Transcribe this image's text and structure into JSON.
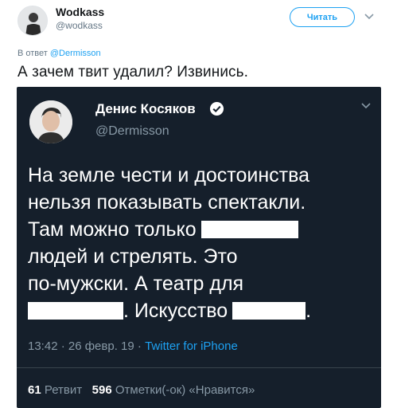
{
  "header": {
    "name": "Wodkass",
    "handle": "@wodkass",
    "follow_label": "Читать"
  },
  "reply": {
    "prefix": "В ответ",
    "mention": "@Dermisson"
  },
  "tweet": {
    "text": "А зачем твит удалил? Извинись."
  },
  "screenshot": {
    "name": "Денис Косяков",
    "handle": "@Dermisson",
    "line1": "На земле чести и достоинства",
    "line2": "нельзя показывать спектакли.",
    "line3": "Там можно только",
    "line4": "людей и стрелять. Это",
    "line5": "по-мужски. А театр для",
    "line6_rest": ". Искусство",
    "line6_end": ".",
    "time_date": "13:42 · 26 февр. 19 · ",
    "source": "Twitter for iPhone",
    "retweets_count": "61",
    "retweets_label": "Ретвит",
    "likes_count": "596",
    "likes_label": "Отметки(-ок) «Нравится»"
  },
  "colors": {
    "brand": "#1da1f2",
    "dark_bg": "#151f2b"
  }
}
